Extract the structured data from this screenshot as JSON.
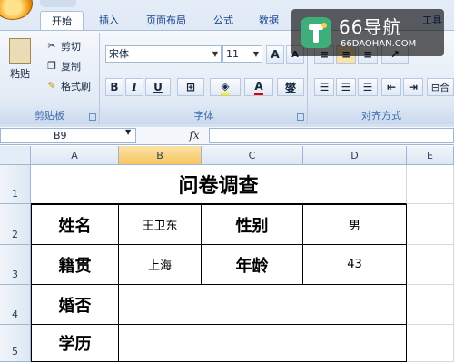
{
  "ribbon": {
    "tabs": [
      "开始",
      "插入",
      "页面布局",
      "公式",
      "数据",
      "工具"
    ],
    "clipboard": {
      "paste": "粘贴",
      "cut": "剪切",
      "copy": "复制",
      "format_painter": "格式刷",
      "group": "剪贴板"
    },
    "font": {
      "name": "宋体",
      "size": "11",
      "grow": "A",
      "shrink": "A",
      "bold": "B",
      "italic": "I",
      "underline": "U",
      "font_color": "A",
      "phonetic": "燮",
      "group": "字体"
    },
    "alignment": {
      "group": "对齐方式",
      "merge": "合"
    }
  },
  "formula_bar": {
    "name_box": "B9",
    "fx": "fx",
    "content": ""
  },
  "columns": [
    "A",
    "B",
    "C",
    "D",
    "E"
  ],
  "rows": [
    "1",
    "2",
    "3",
    "4",
    "5"
  ],
  "sheet": {
    "title": "问卷调查",
    "r2": {
      "label1": "姓名",
      "value1": "王卫东",
      "label2": "性别",
      "value2": "男"
    },
    "r3": {
      "label1": "籍贯",
      "value1": "上海",
      "label2": "年龄",
      "value2": "43"
    },
    "r4": {
      "label1": "婚否"
    },
    "r5": {
      "label1": "学历"
    }
  },
  "watermark": {
    "title": "66导航",
    "subtitle": "66DAOHAN.COM"
  },
  "colors": {
    "accent": "#15428b",
    "selected_header": "#f7c560",
    "watermark_green": "#3fae7a"
  }
}
